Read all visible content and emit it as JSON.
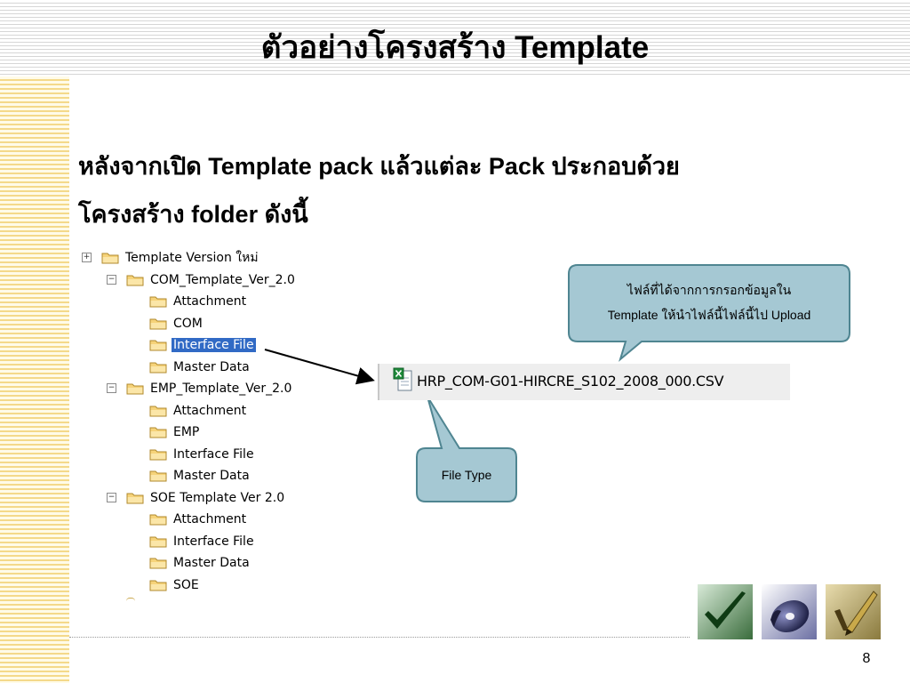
{
  "slide": {
    "title": "ตัวอย่างโครงสร้าง Template",
    "body_lines": [
      "หลังจากเปิด Template pack แล้วแต่ละ Pack ประกอบด้วย",
      "โครงสร้าง folder ดังนี้"
    ],
    "page_number": "8"
  },
  "tree": [
    {
      "label": "Template Version ใหม่",
      "level": 0,
      "expander": "+"
    },
    {
      "label": "COM_Template_Ver_2.0",
      "level": 1,
      "expander": "−"
    },
    {
      "label": "Attachment",
      "level": 2
    },
    {
      "label": "COM",
      "level": 2
    },
    {
      "label": "Interface File",
      "level": 2,
      "selected": true
    },
    {
      "label": "Master Data",
      "level": 2
    },
    {
      "label": "EMP_Template_Ver_2.0",
      "level": 1,
      "expander": "−"
    },
    {
      "label": "Attachment",
      "level": 2
    },
    {
      "label": "EMP",
      "level": 2
    },
    {
      "label": "Interface File",
      "level": 2
    },
    {
      "label": "Master Data",
      "level": 2
    },
    {
      "label": "SOE Template Ver 2.0",
      "level": 1,
      "expander": "−"
    },
    {
      "label": "Attachment",
      "level": 2
    },
    {
      "label": "Interface File",
      "level": 2
    },
    {
      "label": "Master Data",
      "level": 2
    },
    {
      "label": "SOE",
      "level": 2
    }
  ],
  "file": {
    "name": "HRP_COM-G01-HIRCRE_S102_2008_000.CSV",
    "icon": "excel-csv-icon"
  },
  "callouts": {
    "upload_line1": "ไฟล์ที่ได้จากการกรอกข้อมูลใน",
    "upload_line2": "Template ให้นำไฟล์นี้ไฟล์นี้ไป Upload",
    "file_type": "File Type"
  },
  "colors": {
    "callout_fill": "#a5c8d3",
    "callout_stroke": "#4f8591",
    "selection": "#316ac5",
    "folder_fill": "#f6d37a",
    "folder_stroke": "#b08a2e",
    "accent_stripes": "#f4d98a"
  },
  "decor": {
    "thumbnails": [
      "check-mark-image",
      "cd-disc-image",
      "pen-check-image"
    ]
  }
}
